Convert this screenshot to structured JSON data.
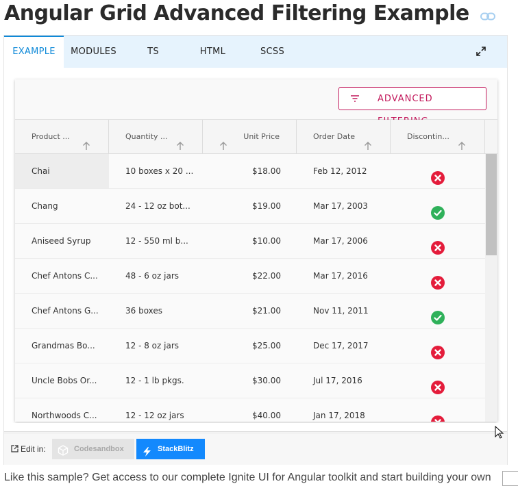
{
  "page": {
    "title": "Angular Grid Advanced Filtering Example",
    "footer_text": "Like this sample? Get access to our complete Ignite UI for Angular toolkit and start building your own"
  },
  "tabs": [
    {
      "label": "EXAMPLE",
      "active": true
    },
    {
      "label": "MODULES",
      "active": false
    },
    {
      "label": "TS",
      "active": false
    },
    {
      "label": "HTML",
      "active": false
    },
    {
      "label": "SCSS",
      "active": false
    }
  ],
  "grid": {
    "toolbar_button": "ADVANCED FILTERING",
    "columns": [
      "Product ...",
      "Quantity ...",
      "Unit Price",
      "Order Date",
      "Discontin..."
    ],
    "rows": [
      {
        "product": "Chai",
        "quantity": "10 boxes x 20 ...",
        "price": "$18.00",
        "date": "Feb 12, 2012",
        "discontinued": true
      },
      {
        "product": "Chang",
        "quantity": "24 - 12 oz bot...",
        "price": "$19.00",
        "date": "Mar 17, 2003",
        "discontinued": false
      },
      {
        "product": "Aniseed Syrup",
        "quantity": "12 - 550 ml b...",
        "price": "$10.00",
        "date": "Mar 17, 2006",
        "discontinued": true
      },
      {
        "product": "Chef Antons C...",
        "quantity": "48 - 6 oz jars",
        "price": "$22.00",
        "date": "Mar 17, 2016",
        "discontinued": true
      },
      {
        "product": "Chef Antons G...",
        "quantity": "36 boxes",
        "price": "$21.00",
        "date": "Nov 11, 2011",
        "discontinued": false
      },
      {
        "product": "Grandmas Bo...",
        "quantity": "12 - 8 oz jars",
        "price": "$25.00",
        "date": "Dec 17, 2017",
        "discontinued": true
      },
      {
        "product": "Uncle Bobs Or...",
        "quantity": "12 - 1 lb pkgs.",
        "price": "$30.00",
        "date": "Jul 17, 2016",
        "discontinued": true
      },
      {
        "product": "Northwoods C...",
        "quantity": "12 - 12 oz jars",
        "price": "$40.00",
        "date": "Jan 17, 2018",
        "discontinued": true
      }
    ]
  },
  "edit": {
    "label": "Edit in:",
    "codesandbox": "Codesandbox",
    "stackblitz": "StackBlitz"
  },
  "colors": {
    "accent": "#0e89d8",
    "filter_button": "#c2185b",
    "discontinued_true": "#e41c3b",
    "discontinued_false": "#2fb15a",
    "stackblitz": "#1389fd"
  },
  "icons": {
    "title": "link-icon",
    "fullscreen": "expand-icon",
    "filter": "filter-lines-icon",
    "sort": "arrow-up-icon",
    "true_value": "x-circle-icon",
    "false_value": "check-circle-icon",
    "edit": "external-edit-icon",
    "codesandbox": "codesandbox-cube-icon",
    "stackblitz": "lightning-bolt-icon"
  }
}
